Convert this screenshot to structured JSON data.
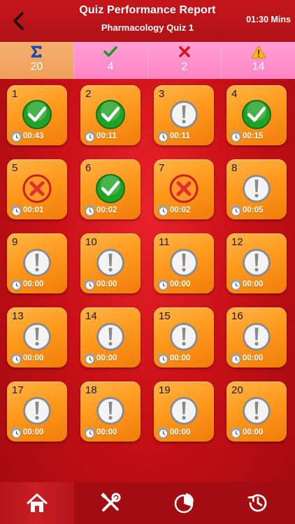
{
  "header": {
    "title": "Quiz Performance Report",
    "subtitle": "Pharmacology Quiz 1",
    "timer": "01:30 Mins"
  },
  "stats": [
    {
      "icon": "sigma-icon",
      "value": "20"
    },
    {
      "icon": "checkmark-icon",
      "value": "4"
    },
    {
      "icon": "cross-icon",
      "value": "2"
    },
    {
      "icon": "warning-icon",
      "value": "14"
    }
  ],
  "colors": {
    "correct": "#22a82a",
    "wrong": "#e0302a",
    "unanswered": "#9a9a9a",
    "tile": "#ff9a1e",
    "background": "#c81016"
  },
  "questions": [
    {
      "number": "1",
      "status": "correct",
      "time": "00:43"
    },
    {
      "number": "2",
      "status": "correct",
      "time": "00:11"
    },
    {
      "number": "3",
      "status": "unanswered",
      "time": "00:11"
    },
    {
      "number": "4",
      "status": "correct",
      "time": "00:15"
    },
    {
      "number": "5",
      "status": "wrong",
      "time": "00:01"
    },
    {
      "number": "6",
      "status": "correct",
      "time": "00:02"
    },
    {
      "number": "7",
      "status": "wrong",
      "time": "00:02"
    },
    {
      "number": "8",
      "status": "unanswered",
      "time": "00:05"
    },
    {
      "number": "9",
      "status": "unanswered",
      "time": "00:00"
    },
    {
      "number": "10",
      "status": "unanswered",
      "time": "00:00"
    },
    {
      "number": "11",
      "status": "unanswered",
      "time": "00:00"
    },
    {
      "number": "12",
      "status": "unanswered",
      "time": "00:00"
    },
    {
      "number": "13",
      "status": "unanswered",
      "time": "00:00"
    },
    {
      "number": "14",
      "status": "unanswered",
      "time": "00:00"
    },
    {
      "number": "15",
      "status": "unanswered",
      "time": "00:00"
    },
    {
      "number": "16",
      "status": "unanswered",
      "time": "00:00"
    },
    {
      "number": "17",
      "status": "unanswered",
      "time": "00:00"
    },
    {
      "number": "18",
      "status": "unanswered",
      "time": "00:00"
    },
    {
      "number": "19",
      "status": "unanswered",
      "time": "00:00"
    },
    {
      "number": "20",
      "status": "unanswered",
      "time": "00:00"
    }
  ],
  "nav": [
    {
      "icon": "home-icon",
      "active": true
    },
    {
      "icon": "tools-icon",
      "active": false
    },
    {
      "icon": "pie-chart-icon",
      "active": false
    },
    {
      "icon": "history-icon",
      "active": false
    }
  ]
}
